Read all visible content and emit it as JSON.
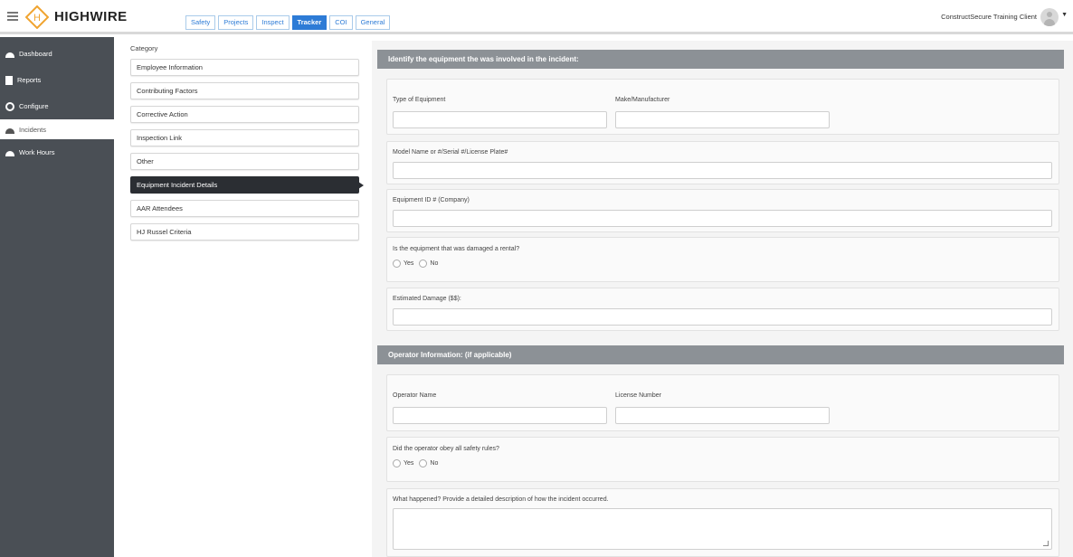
{
  "app": {
    "brand": "HIGHWIRE",
    "client": "ConstructSecure Training Client"
  },
  "tabs": [
    {
      "label": "Safety"
    },
    {
      "label": "Projects"
    },
    {
      "label": "Inspect"
    },
    {
      "label": "Tracker"
    },
    {
      "label": "COI"
    },
    {
      "label": "General"
    }
  ],
  "active_tab": "Tracker",
  "sidebar": {
    "items": [
      {
        "label": "Dashboard",
        "icon": "dashboard-icon"
      },
      {
        "label": "Reports",
        "icon": "document-icon"
      },
      {
        "label": "Configure",
        "icon": "gear-icon"
      },
      {
        "label": "Incidents",
        "icon": "dashboard-icon"
      },
      {
        "label": "Work Hours",
        "icon": "dashboard-icon"
      }
    ],
    "active": "Incidents"
  },
  "category": {
    "title": "Category",
    "items": [
      {
        "label": "Employee Information"
      },
      {
        "label": "Contributing Factors"
      },
      {
        "label": "Corrective Action"
      },
      {
        "label": "Inspection Link"
      },
      {
        "label": "Other"
      },
      {
        "label": "Equipment Incident Details"
      },
      {
        "label": "AAR Attendees"
      },
      {
        "label": "HJ Russel Criteria"
      }
    ],
    "active": "Equipment Incident Details"
  },
  "form": {
    "equipment_section": "Identify the equipment the was involved in the incident:",
    "type_of_equipment": {
      "label": "Type of Equipment",
      "value": ""
    },
    "make_manufacturer": {
      "label": "Make/Manufacturer",
      "value": ""
    },
    "model_serial": {
      "label": "Model Name or #/Serial #/License Plate#",
      "value": ""
    },
    "equipment_id": {
      "label": "Equipment ID # (Company)",
      "value": ""
    },
    "rental_question": {
      "label": "Is the equipment that was damaged a rental?",
      "yes": "Yes",
      "no": "No"
    },
    "estimated_damage": {
      "label": "Estimated Damage ($$):",
      "value": ""
    },
    "operator_section": "Operator Information: (if applicable)",
    "operator_name": {
      "label": "Operator Name",
      "value": ""
    },
    "license_number": {
      "label": "License Number",
      "value": ""
    },
    "safety_rules_question": {
      "label": "Did the operator obey all safety rules?",
      "yes": "Yes",
      "no": "No"
    },
    "what_happened": {
      "label": "What happened? Provide a detailed description of how the incident occurred.",
      "value": ""
    }
  },
  "colors": {
    "accent": "#2d7bd6",
    "sidebar": "#4a4f55",
    "section_header": "#8c9196",
    "active_category": "#2b2e33"
  }
}
